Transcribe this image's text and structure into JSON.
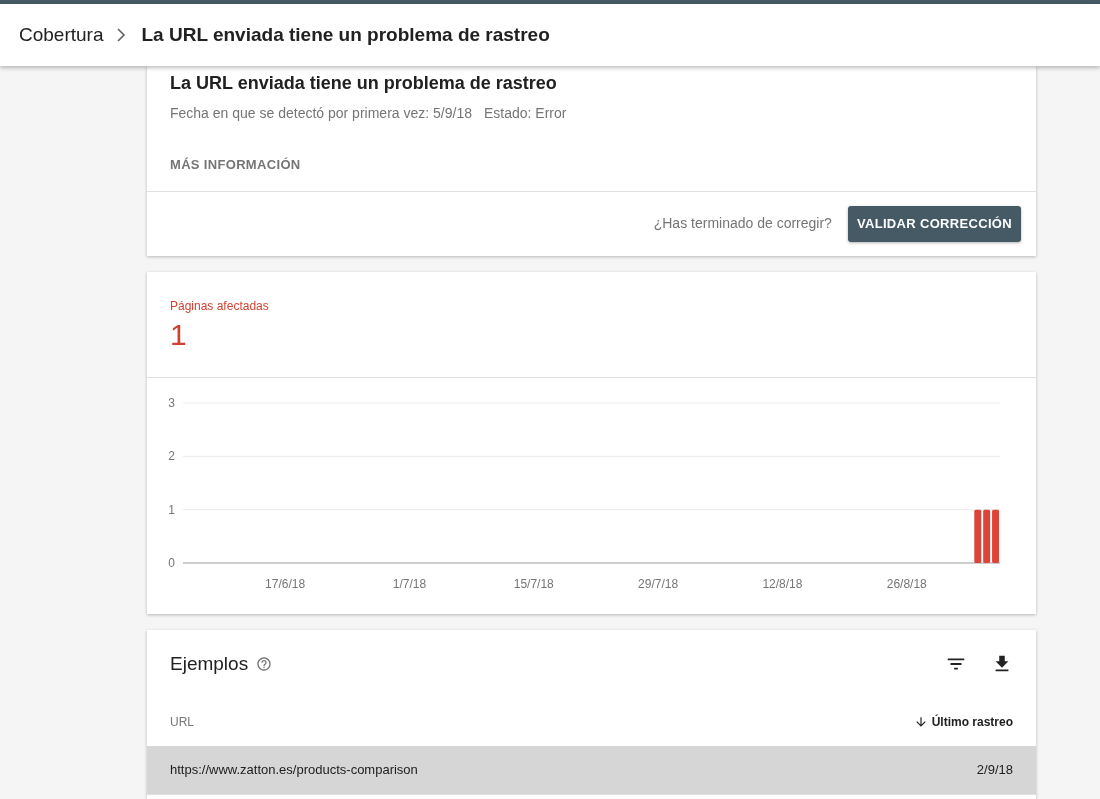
{
  "breadcrumb": {
    "parent": "Cobertura",
    "current": "La URL enviada tiene un problema de rastreo"
  },
  "issue": {
    "title": "La URL enviada tiene un problema de rastreo",
    "first_detected": "Fecha en que se detectó por primera vez: 5/9/18",
    "status": "Estado: Error",
    "more_info": "MÁS INFORMACIÓN",
    "prompt": "¿Has terminado de corregir?",
    "validate_button": "VALIDAR CORRECCIÓN"
  },
  "affected": {
    "label": "Páginas afectadas",
    "count": "1",
    "chart_data": {
      "type": "bar",
      "ylim": [
        0,
        3
      ],
      "yticks": [
        0,
        1,
        2,
        3
      ],
      "categories": [
        null,
        null,
        null,
        null,
        null,
        null,
        null,
        null,
        null,
        null,
        null,
        "17/6/18",
        null,
        null,
        null,
        null,
        null,
        null,
        null,
        null,
        null,
        null,
        null,
        null,
        null,
        "1/7/18",
        null,
        null,
        null,
        null,
        null,
        null,
        null,
        null,
        null,
        null,
        null,
        null,
        null,
        "15/7/18",
        null,
        null,
        null,
        null,
        null,
        null,
        null,
        null,
        null,
        null,
        null,
        null,
        null,
        "29/7/18",
        null,
        null,
        null,
        null,
        null,
        null,
        null,
        null,
        null,
        null,
        null,
        null,
        null,
        "12/8/18",
        null,
        null,
        null,
        null,
        null,
        null,
        null,
        null,
        null,
        null,
        null,
        null,
        null,
        "26/8/18",
        null,
        null,
        null,
        null,
        null,
        null,
        null,
        null,
        null,
        null
      ],
      "series": [
        {
          "color": "#db4437",
          "values": [
            null,
            null,
            null,
            null,
            null,
            null,
            null,
            null,
            null,
            null,
            null,
            null,
            null,
            null,
            null,
            null,
            null,
            null,
            null,
            null,
            null,
            null,
            null,
            null,
            null,
            null,
            null,
            null,
            null,
            null,
            null,
            null,
            null,
            null,
            null,
            null,
            null,
            null,
            null,
            null,
            null,
            null,
            null,
            null,
            null,
            null,
            null,
            null,
            null,
            null,
            null,
            null,
            null,
            null,
            null,
            null,
            null,
            null,
            null,
            null,
            null,
            null,
            null,
            null,
            null,
            null,
            null,
            null,
            null,
            null,
            null,
            null,
            null,
            null,
            null,
            null,
            null,
            null,
            null,
            null,
            null,
            null,
            null,
            null,
            null,
            null,
            null,
            null,
            null,
            1,
            1,
            1
          ]
        }
      ]
    }
  },
  "examples": {
    "title": "Ejemplos",
    "columns": [
      {
        "label": "URL",
        "sorted": false
      },
      {
        "label": "Último rastreo",
        "sorted": true
      }
    ],
    "rows": [
      {
        "url": "https://www.zatton.es/products-comparison",
        "last_crawl": "2/9/18",
        "selected": true
      }
    ]
  }
}
